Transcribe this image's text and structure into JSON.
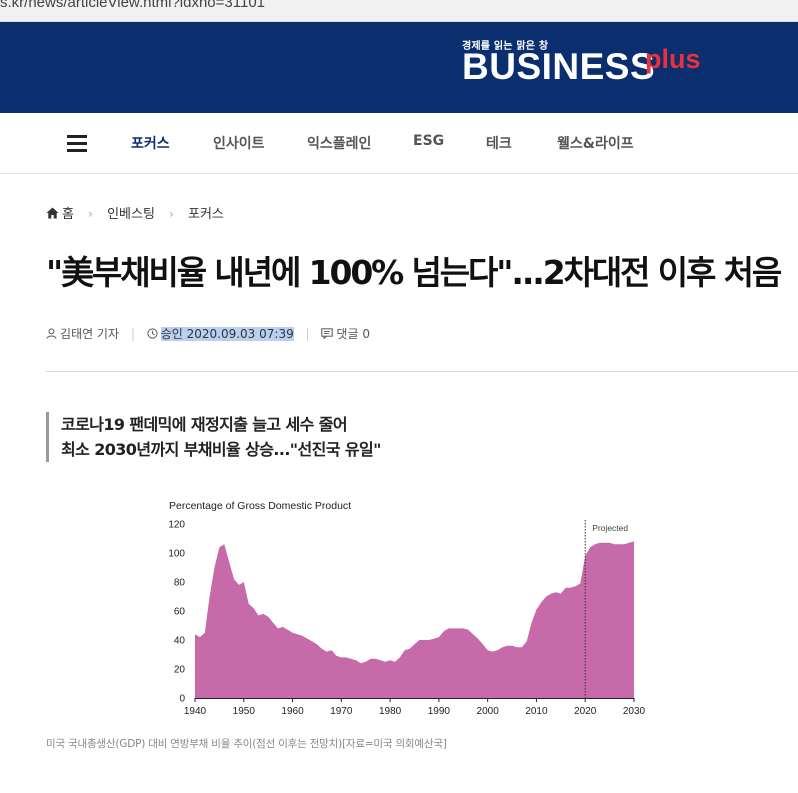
{
  "browser": {
    "url": "s.kr/news/articleView.html?idxno=31101"
  },
  "brand": {
    "slogan": "경제를 읽는 맑은 창",
    "logo_main": "BUSINESS",
    "logo_plus": "plus",
    "bg_color": "#0b2e6f",
    "accent_color": "#e8313a"
  },
  "nav": {
    "menu_icon": "hamburger-menu-icon",
    "items": [
      {
        "label": "포커스"
      },
      {
        "label": "인사이트"
      },
      {
        "label": "익스플레인"
      },
      {
        "label": "ESG"
      },
      {
        "label": "테크"
      },
      {
        "label": "웰스&라이프"
      }
    ],
    "active_index": 0
  },
  "breadcrumb": {
    "home": "홈",
    "items": [
      "인베스팅",
      "포커스"
    ]
  },
  "article": {
    "headline": "\"美부채비율 내년에 100% 넘는다\"...2차대전 이후 처음",
    "author": "김태연 기자",
    "approved": "승인 2020.09.03 07:39",
    "comments": "댓글 0",
    "subheads": [
      "코로나19 팬데믹에 재정지출 늘고 세수 줄어",
      "최소 2030년까지 부채비율 상승...\"선진국 유일\""
    ],
    "caption": "미국 국내총생산(GDP) 대비 연방부채 비율 추이(점선 이후는 전망치)[자료=미국 의회예산국]"
  },
  "chart_data": {
    "type": "area",
    "title": "Percentage of Gross Domestic Product",
    "xlabel": "",
    "ylabel": "",
    "xlim": [
      1940,
      2030
    ],
    "ylim": [
      0,
      120
    ],
    "x_ticks": [
      1940,
      1950,
      1960,
      1970,
      1980,
      1990,
      2000,
      2010,
      2020,
      2030
    ],
    "y_ticks": [
      0,
      20,
      40,
      60,
      80,
      100,
      120
    ],
    "projection_start": 2020,
    "annotation": "Projected",
    "color": "#c76aa9",
    "series": [
      {
        "x": [
          1940,
          1941,
          1942,
          1943,
          1944,
          1945,
          1946,
          1947,
          1948,
          1949,
          1950,
          1951,
          1952,
          1953,
          1954,
          1955,
          1956,
          1957,
          1958,
          1959,
          1960,
          1961,
          1962,
          1963,
          1964,
          1965,
          1966,
          1967,
          1968,
          1969,
          1970,
          1971,
          1972,
          1973,
          1974,
          1975,
          1976,
          1977,
          1978,
          1979,
          1980,
          1981,
          1982,
          1983,
          1984,
          1985,
          1986,
          1987,
          1988,
          1989,
          1990,
          1991,
          1992,
          1993,
          1994,
          1995,
          1996,
          1997,
          1998,
          1999,
          2000,
          2001,
          2002,
          2003,
          2004,
          2005,
          2006,
          2007,
          2008,
          2009,
          2010,
          2011,
          2012,
          2013,
          2014,
          2015,
          2016,
          2017,
          2018,
          2019,
          2020,
          2021,
          2022,
          2023,
          2024,
          2025,
          2026,
          2027,
          2028,
          2029,
          2030
        ],
        "values": [
          44,
          42,
          45,
          70,
          90,
          104,
          106,
          94,
          82,
          78,
          80,
          65,
          62,
          57,
          58,
          56,
          52,
          48,
          49,
          47,
          45,
          44,
          43,
          41,
          39,
          37,
          34,
          32,
          33,
          29,
          28,
          28,
          27,
          26,
          24,
          25,
          27,
          27,
          26,
          25,
          26,
          25,
          28,
          33,
          34,
          37,
          40,
          40,
          40,
          41,
          42,
          46,
          48,
          48,
          48,
          48,
          47,
          44,
          41,
          37,
          33,
          32,
          33,
          35,
          36,
          36,
          35,
          35,
          39,
          52,
          61,
          66,
          70,
          72,
          73,
          72,
          76,
          76,
          77,
          79,
          98,
          104,
          106,
          107,
          107,
          107,
          106,
          106,
          106,
          107,
          108
        ]
      }
    ]
  }
}
